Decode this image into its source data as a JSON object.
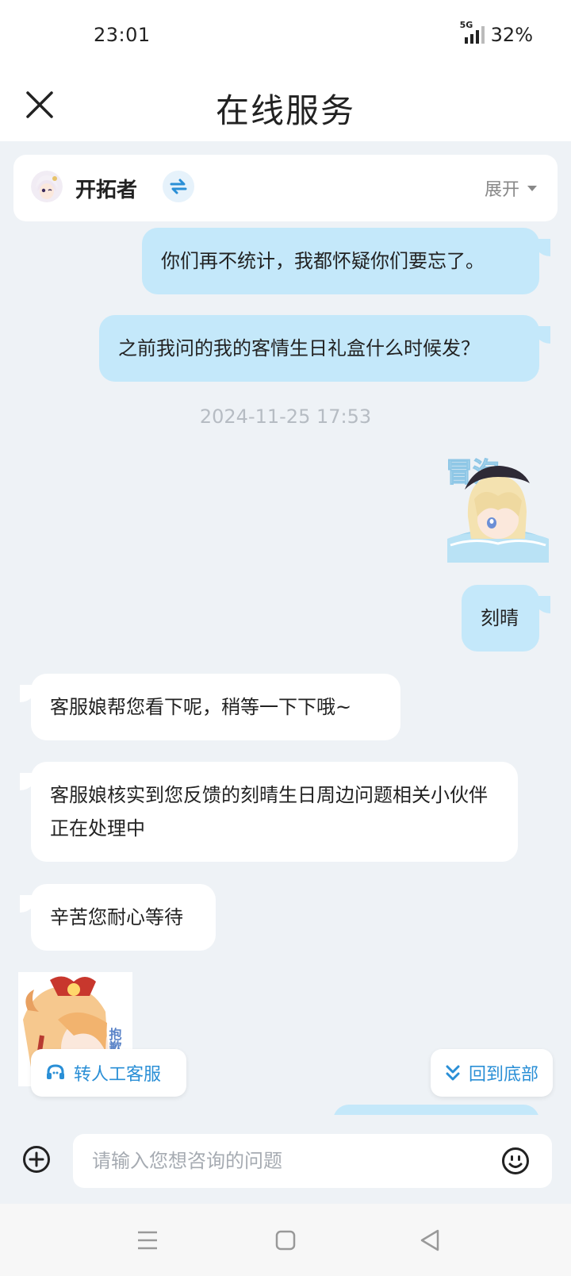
{
  "status_bar": {
    "time": "23:01",
    "network": "5G",
    "battery": "32%"
  },
  "header": {
    "title": "在线服务"
  },
  "user_bar": {
    "name": "开拓者",
    "expand_label": "展开"
  },
  "messages": [
    {
      "side": "me",
      "text": "你们再不统计，我都怀疑你们要忘了。"
    },
    {
      "side": "me",
      "text": "之前我问的我的客情生日礼盒什么时候发？"
    },
    {
      "side": "me",
      "text": "刻晴"
    },
    {
      "side": "them",
      "text": "客服娘帮您看下呢，稍等一下下哦~"
    },
    {
      "side": "them",
      "text": "客服娘核实到您反馈的刻晴生日周边问题相关小伙伴正在处理中"
    },
    {
      "side": "them",
      "text": "辛苦您耐心等待"
    }
  ],
  "timestamp": "2024-11-25 17:53",
  "stickers": {
    "me_text": "冒泡",
    "them_text": "抱歉"
  },
  "buttons": {
    "human_service": "转人工客服",
    "back_to_bottom": "回到底部"
  },
  "input": {
    "placeholder": "请输入您想咨询的问题",
    "value": ""
  },
  "colors": {
    "accent": "#2a8fd6",
    "my_bubble": "#c4e8fa",
    "their_bubble": "#ffffff",
    "background": "#eef2f6"
  }
}
